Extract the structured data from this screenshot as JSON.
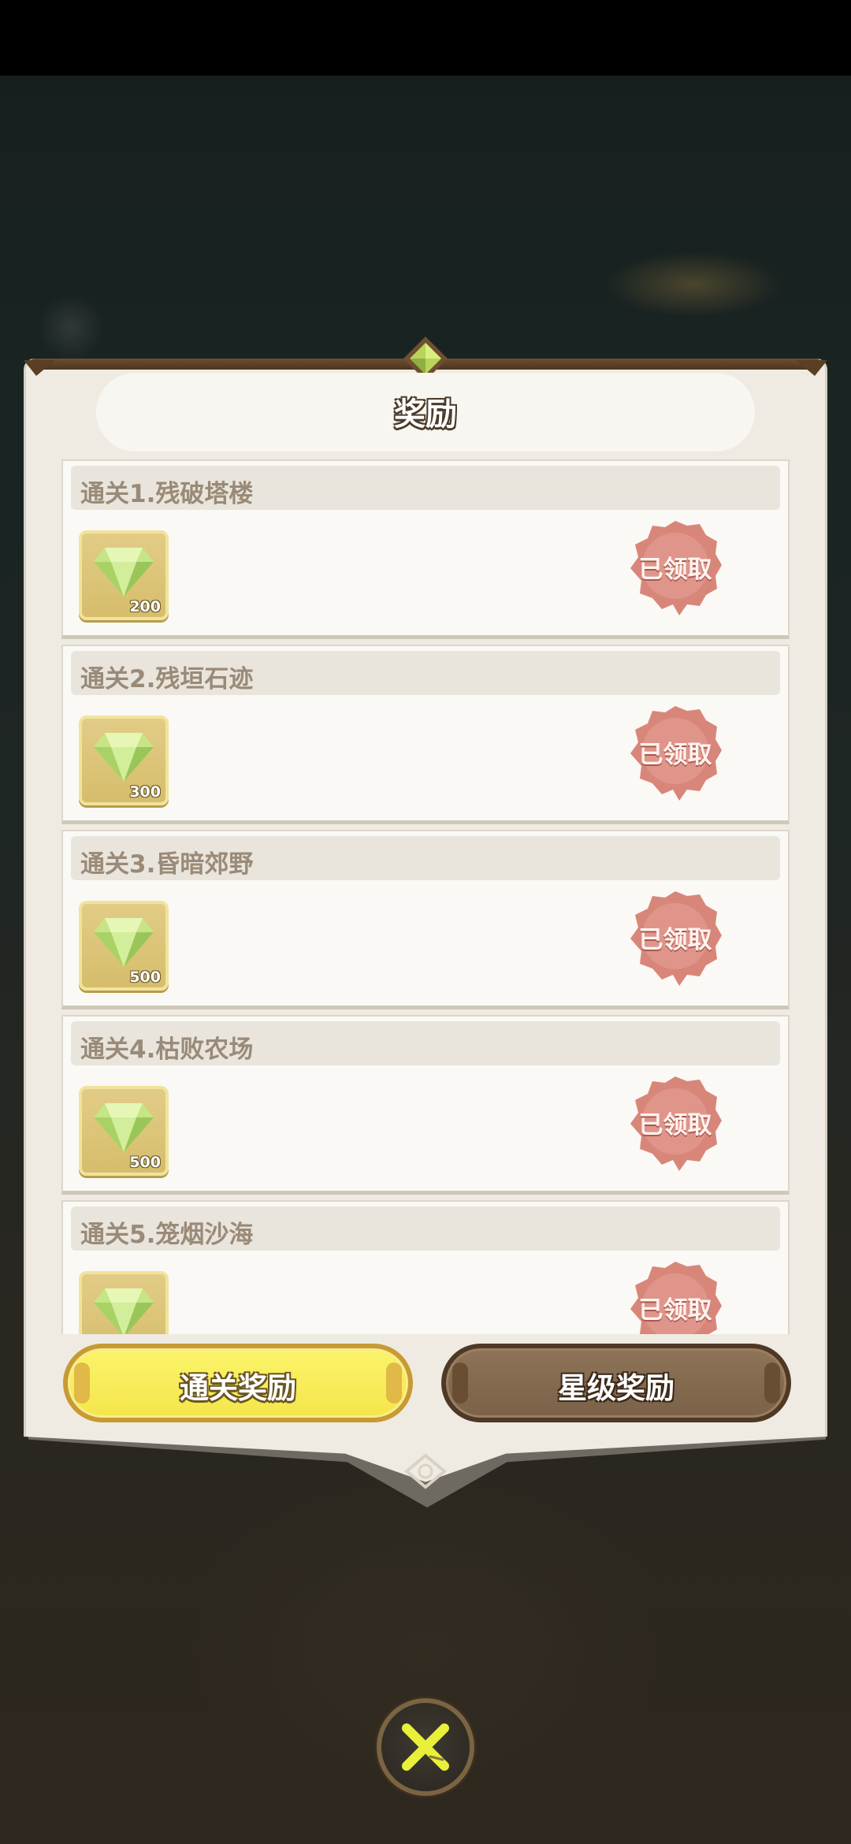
{
  "dialog": {
    "title": "奖励"
  },
  "rewards": [
    {
      "title": "通关1.残破塔楼",
      "item_icon": "green-gem-icon",
      "quantity": "200",
      "status": "已领取"
    },
    {
      "title": "通关2.残垣石迹",
      "item_icon": "green-gem-icon",
      "quantity": "300",
      "status": "已领取"
    },
    {
      "title": "通关3.昏暗郊野",
      "item_icon": "green-gem-icon",
      "quantity": "500",
      "status": "已领取"
    },
    {
      "title": "通关4.枯败农场",
      "item_icon": "green-gem-icon",
      "quantity": "500",
      "status": "已领取"
    },
    {
      "title": "通关5.笼烟沙海",
      "item_icon": "green-gem-icon",
      "quantity": "",
      "status": "已领取"
    }
  ],
  "tabs": [
    {
      "label": "通关奖励",
      "active": true
    },
    {
      "label": "星级奖励",
      "active": false
    }
  ],
  "colors": {
    "active_tab": "#f4e64b",
    "inactive_tab": "#7b6248",
    "claimed_stamp": "#d9867a",
    "panel": "#efebe2"
  },
  "close": {
    "icon": "close-icon"
  }
}
